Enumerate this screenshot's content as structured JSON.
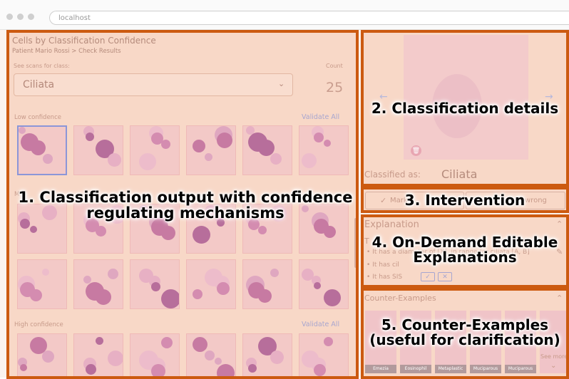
{
  "browser": {
    "url": "localhost"
  },
  "left": {
    "title": "Cells by Classification Confidence",
    "breadcrumb": "Patient Mario Rossi > Check Results",
    "class_label": "See scans for class:",
    "count_label": "Count",
    "selected_class": "Ciliata",
    "count": "25",
    "low_label": "Low confidence",
    "medium_label": "M",
    "high_label": "High confidence",
    "validate_all": "Validate All"
  },
  "details": {
    "classified_as_label": "Classified as:",
    "classified_as_value": "Ciliata"
  },
  "intervention": {
    "mark_label": "Mark",
    "wrong_label": "wrong"
  },
  "explanation": {
    "title": "Explanation",
    "first_line_prefix": "T",
    "items": [
      "It has a diameter of [X], in range for ciliata [A, B]",
      "It has cil",
      "It has SIS"
    ]
  },
  "counter": {
    "title": "Counter-Examples",
    "see_more": "See more",
    "captions": [
      "Emezia",
      "Eosinophil",
      "Metaplastic",
      "Muciparous",
      "Muciparous"
    ]
  },
  "overlay": {
    "label1": "1. Classification output with confidence regulating mechanisms",
    "label2": "2. Classification details",
    "label3": "3. Intervention",
    "label4": "4. On-Demand Editable Explanations",
    "label5": "5. Counter-Examples (useful for clarification)"
  }
}
